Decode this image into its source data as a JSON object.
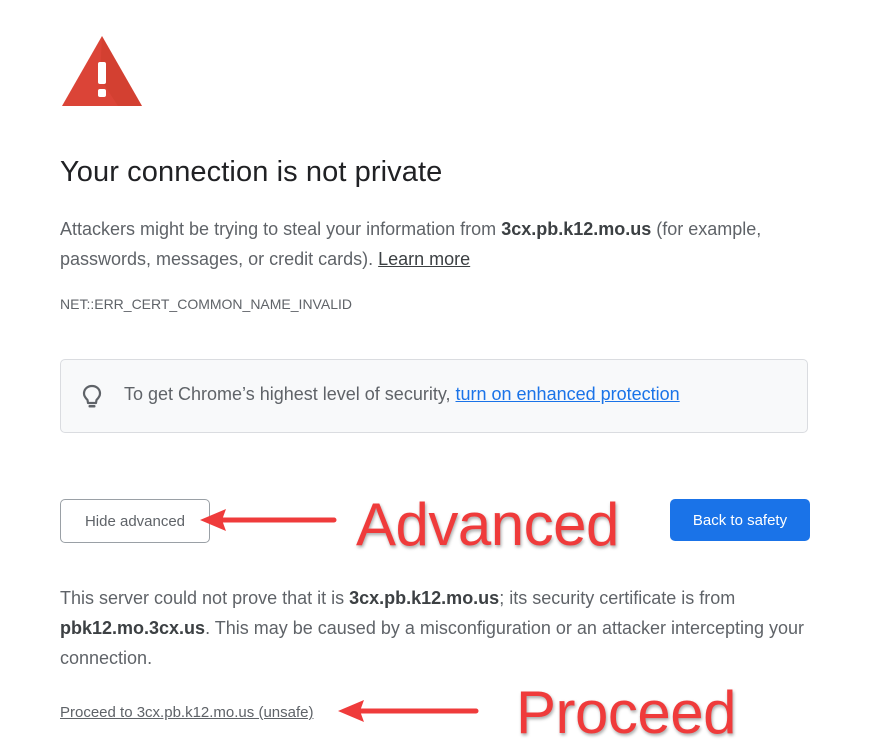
{
  "page": {
    "title": "Your connection is not private",
    "intro_before": "Attackers might be trying to steal your information from ",
    "intro_domain": "3cx.pb.k12.mo.us",
    "intro_after": " (for example, passwords, messages, or credit cards). ",
    "learn_more": "Learn more",
    "error_code": "NET::ERR_CERT_COMMON_NAME_INVALID"
  },
  "protection": {
    "icon": "lightbulb-icon",
    "text": "To get Chrome’s highest level of security, ",
    "link": "turn on enhanced protection"
  },
  "buttons": {
    "hide_advanced": "Hide advanced",
    "back_to_safety": "Back to safety"
  },
  "details": {
    "part1": "This server could not prove that it is ",
    "domain": "3cx.pb.k12.mo.us",
    "part2": "; its security certificate is from ",
    "cert_domain": "pbk12.mo.3cx.us",
    "part3": ". This may be caused by a misconfiguration or an attacker intercepting your connection."
  },
  "proceed_link": "Proceed to 3cx.pb.k12.mo.us (unsafe)",
  "annotations": {
    "advanced": "Advanced",
    "proceed": "Proceed"
  },
  "colors": {
    "warning_red": "#db4437",
    "primary_blue": "#1a73e8",
    "annotation_red": "#ef3b3b",
    "text_gray": "#5f6368"
  }
}
